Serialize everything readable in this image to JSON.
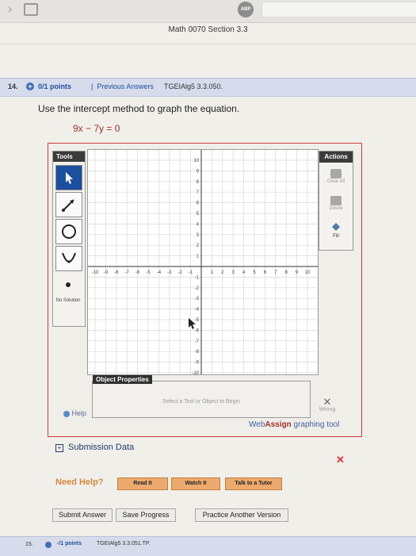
{
  "browser": {
    "adblock_label": "ABP",
    "page_title": "Math 0070 Section 3.3",
    "icons": [
      "chevron-left-icon",
      "tab-overview-icon",
      "adblock-icon"
    ]
  },
  "question": {
    "number": "14.",
    "points": "0/1 points",
    "separator": "|",
    "previous_answers": "Previous Answers",
    "code": "TGEIAlg5 3.3.050.",
    "instruction": "Use the intercept method to graph the equation.",
    "equation": "9x − 7y = 0"
  },
  "tools": {
    "title": "Tools",
    "items": [
      "pointer-tool",
      "line-tool",
      "circle-tool",
      "parabola-tool",
      "point-tool"
    ],
    "no_solution": "No Solution"
  },
  "actions": {
    "title": "Actions",
    "clear_all": "Clear All",
    "delete": "Delete",
    "fill": "Fill"
  },
  "graph": {
    "x_min": -10,
    "x_max": 10,
    "y_min": -10,
    "y_max": 10,
    "x_ticks": [
      "-10",
      "-9",
      "-8",
      "-7",
      "-6",
      "-5",
      "-4",
      "-3",
      "-2",
      "-1",
      "1",
      "2",
      "3",
      "4",
      "5",
      "6",
      "7",
      "8",
      "9",
      "10"
    ],
    "y_ticks": [
      "10",
      "9",
      "8",
      "7",
      "6",
      "5",
      "4",
      "3",
      "2",
      "1",
      "-1",
      "-2",
      "-3",
      "-4",
      "-5",
      "-6",
      "-7",
      "-8",
      "-9",
      "-10"
    ],
    "grid": true
  },
  "object_properties": {
    "title": "Object Properties",
    "hint": "Select a Tool or Object to Begin"
  },
  "help_label": "Help",
  "result": {
    "symbol": "✕",
    "label": "Wrong",
    "color": "#666666"
  },
  "brand": {
    "web": "Web",
    "assign": "Assign",
    "suffix": " graphing tool"
  },
  "submission_data": {
    "toggle": "+",
    "label": "Submission Data",
    "status_symbol": "✕",
    "status_color": "#dd3333"
  },
  "need_help": {
    "label": "Need Help?",
    "buttons": [
      "Read It",
      "Watch It",
      "Talk to a Tutor"
    ]
  },
  "bottom_buttons": [
    "Submit Answer",
    "Save Progress",
    "Practice Another Version"
  ],
  "next_question": {
    "number": "15.",
    "points": "-/1 points",
    "code": "TGEIAlg5 3.3.051.TP."
  }
}
